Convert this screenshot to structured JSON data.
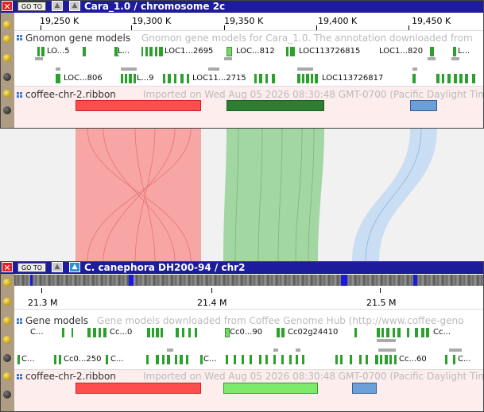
{
  "colors": {
    "header": "#1c1c9c",
    "gene": "#2ca02c",
    "ribbon_red": "#ff4d4d",
    "ribbon_green_dark": "#2e7d32",
    "ribbon_green_light": "#7dea6b",
    "ribbon_blue": "#6a9fd8"
  },
  "top_view": {
    "goto_label": "GO TO",
    "assembly": "Cara_1.0",
    "sep": " / ",
    "chrom": "chromosome 2c",
    "ruler": [
      "19,250 K",
      "19,300 K",
      "19,350 K",
      "19,400 K",
      "19,450 K"
    ],
    "track1": {
      "name": "Gnomon gene models",
      "desc": "Gnomon gene models for Cara_1.0. The annotation downloaded from",
      "row1_labels": [
        "LO...5",
        "L...",
        "LOC1...2695",
        "LOC...812",
        "LOC113726815",
        "LOC1...820",
        "L..."
      ],
      "row2_labels": [
        "LOC...806",
        "L...9",
        "LOC11...2715",
        "LOC113726817"
      ]
    },
    "track2": {
      "name": "coffee-chr-2.ribbon",
      "desc": "Imported on Wed Aug 05 2026 08:30:48 GMT-0700 (Pacific Daylight Tim"
    }
  },
  "bottom_view": {
    "goto_label": "GO TO",
    "assembly": "C. canephora DH200-94",
    "sep": " / ",
    "chrom": "chr2",
    "ruler": [
      "21.3 M",
      "21.4 M",
      "21.5 M"
    ],
    "track1": {
      "name": "Gene models",
      "desc": "Gene models downloaded from Coffee Genome Hub  (http://www.coffee-geno",
      "row1_labels": [
        "C...",
        "Cc...0",
        "Cc0...90",
        "Cc02g24410",
        "Cc..."
      ],
      "row2_labels": [
        "C...",
        "Cc0...250",
        "C...",
        "C...",
        "Cc...60",
        "C..."
      ]
    },
    "track2": {
      "name": "coffee-chr-2.ribbon",
      "desc": "Imported on Wed Aug 05 2026 08:30:48 GMT-0700 (Pacific Daylight Tim"
    }
  }
}
